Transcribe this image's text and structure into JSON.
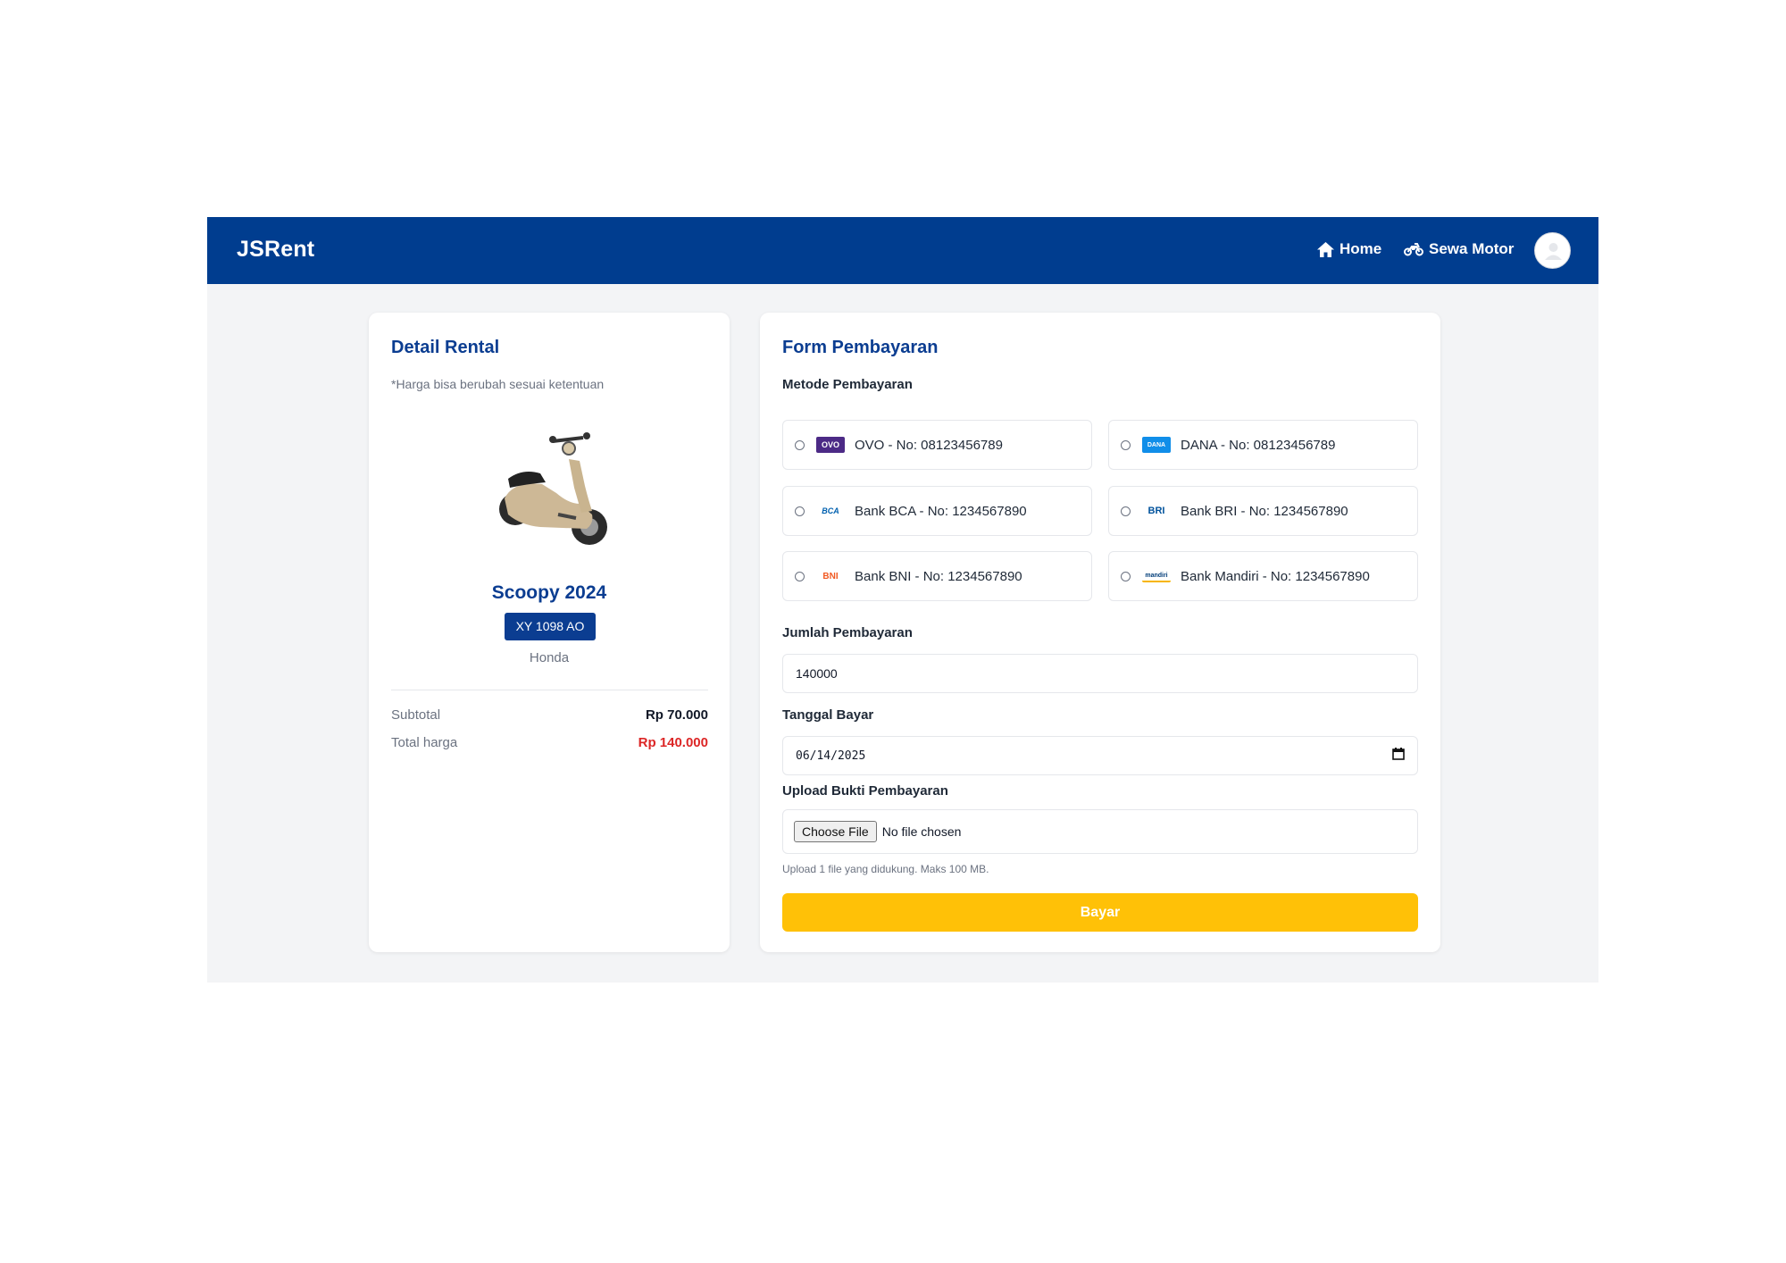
{
  "navbar": {
    "brand": "JSRent",
    "home_label": "Home",
    "sewa_label": "Sewa Motor"
  },
  "detail": {
    "title": "Detail Rental",
    "note": "*Harga bisa berubah sesuai ketentuan",
    "motor_name": "Scoopy 2024",
    "plate": "XY 1098 AO",
    "brand": "Honda",
    "subtotal_label": "Subtotal",
    "subtotal_value": "Rp 70.000",
    "total_label": "Total harga",
    "total_value": "Rp 140.000"
  },
  "form": {
    "title": "Form Pembayaran",
    "method_label": "Metode Pembayaran",
    "methods": [
      {
        "logo": "OVO",
        "label": "OVO - No: 08123456789"
      },
      {
        "logo": "DANA",
        "label": "DANA - No: 08123456789"
      },
      {
        "logo": "BCA",
        "label": "Bank BCA - No: 1234567890"
      },
      {
        "logo": "BRI",
        "label": "Bank BRI - No: 1234567890"
      },
      {
        "logo": "BNI",
        "label": "Bank BNI - No: 1234567890"
      },
      {
        "logo": "mandiri",
        "label": "Bank Mandiri - No: 1234567890"
      }
    ],
    "amount_label": "Jumlah Pembayaran",
    "amount_value": "140000",
    "date_label": "Tanggal Bayar",
    "date_value": "06/14/2025",
    "upload_label": "Upload Bukti Pembayaran",
    "file_button": "Choose File",
    "file_status": "No file chosen",
    "upload_hint": "Upload 1 file yang didukung. Maks 100 MB.",
    "submit_label": "Bayar"
  },
  "colors": {
    "navbar": "#003d8f",
    "accent_blue": "#0b3d91",
    "pay_button": "#ffc107",
    "total_red": "#dc2626"
  },
  "icons": [
    "home-icon",
    "motorcycle-icon",
    "user-avatar-icon",
    "calendar-icon"
  ]
}
